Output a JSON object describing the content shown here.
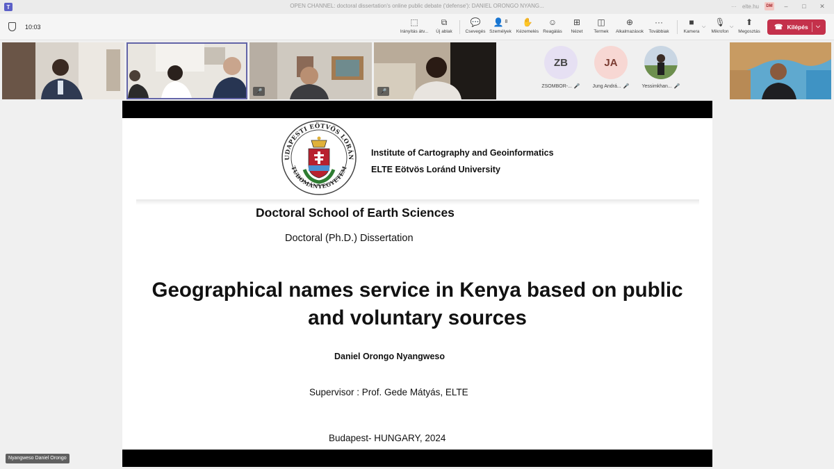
{
  "window": {
    "title": "OPEN CHANNEL: doctoral dissertation's online public debate ('defense'): DANIEL ORONGO NYANG...",
    "account": "elte.hu",
    "avatar_initials": "DM",
    "more": "···"
  },
  "toolbar": {
    "timer": "10:03",
    "items": [
      {
        "label": "Irányítás átv...",
        "icon": "take-control-icon"
      },
      {
        "label": "Új ablak",
        "icon": "new-window-icon"
      },
      {
        "label": "Csevegés",
        "icon": "chat-icon"
      },
      {
        "label": "Személyek",
        "icon": "people-icon",
        "count": "8"
      },
      {
        "label": "Kézemelés",
        "icon": "raise-hand-icon"
      },
      {
        "label": "Reagálás",
        "icon": "react-icon"
      },
      {
        "label": "Nézet",
        "icon": "view-icon"
      },
      {
        "label": "Termek",
        "icon": "rooms-icon"
      },
      {
        "label": "Alkalmazások",
        "icon": "apps-icon"
      },
      {
        "label": "Továbbiak",
        "icon": "more-icon"
      },
      {
        "label": "Kamera",
        "icon": "camera-icon"
      },
      {
        "label": "Mikrofon",
        "icon": "mic-off-icon"
      },
      {
        "label": "Megosztás",
        "icon": "share-icon"
      }
    ],
    "leave_label": "Kilépés",
    "leave_color": "#c4314b"
  },
  "participants": {
    "roster": [
      {
        "initials": "ZB",
        "name": "ZSOMBOR-...",
        "color": "#e6e0f3"
      },
      {
        "initials": "JA",
        "name": "Jung Andrá...",
        "color": "#f7d7d3"
      },
      {
        "initials": "",
        "name": "Yessimkhan...",
        "color": "#c9d6e3"
      }
    ]
  },
  "slide": {
    "institute": "Institute of Cartography and Geoinformatics",
    "university": "ELTE Eötvös Loránd University",
    "school": "Doctoral School of Earth Sciences",
    "dissertation": "Doctoral (Ph.D.) Dissertation",
    "title_line1": "Geographical names service in Kenya based on public",
    "title_line2": "and voluntary sources",
    "author": "Daniel Orongo Nyangweso",
    "supervisor": "Supervisor : Prof. Gede Mátyás, ELTE",
    "place": "Budapest- HUNGARY,  2024",
    "seal_text_top": "BUDAPESTI EÖTVÖS LORÁND",
    "seal_text_bottom": "TUDOMÁNYEGYETEM"
  },
  "presenter": "Nyangweso Daniel Orongo"
}
